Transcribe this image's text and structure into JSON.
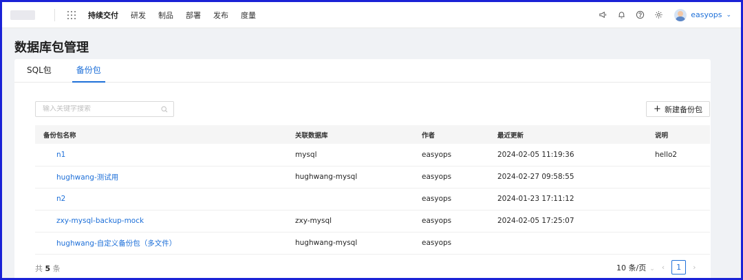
{
  "nav": {
    "items": [
      "持续交付",
      "研发",
      "制品",
      "部署",
      "发布",
      "度量"
    ],
    "username": "easyops"
  },
  "page": {
    "title": "数据库包管理"
  },
  "tabs": [
    {
      "label": "SQL包",
      "active": false
    },
    {
      "label": "备份包",
      "active": true
    }
  ],
  "search": {
    "placeholder": "输入关键字搜索",
    "value": ""
  },
  "new_button": {
    "label": "新建备份包"
  },
  "table": {
    "columns": [
      "备份包名称",
      "关联数据库",
      "作者",
      "最近更新",
      "说明"
    ],
    "rows": [
      [
        "n1",
        "mysql",
        "easyops",
        "2024-02-05 11:19:36",
        "hello2"
      ],
      [
        "hughwang-测试用",
        "hughwang-mysql",
        "easyops",
        "2024-02-27 09:58:55",
        ""
      ],
      [
        "n2",
        "",
        "easyops",
        "2024-01-23 17:11:12",
        ""
      ],
      [
        "zxy-mysql-backup-mock",
        "zxy-mysql",
        "easyops",
        "2024-02-05 17:25:07",
        ""
      ],
      [
        "hughwang-自定义备份包（多文件）",
        "hughwang-mysql",
        "easyops",
        "",
        ""
      ]
    ]
  },
  "footer": {
    "total_prefix": "共",
    "total_count": "5",
    "total_suffix": "条",
    "page_size": "10 条/页",
    "current_page": "1"
  },
  "colors": {
    "accent": "#1d6fd8",
    "frame": "#1a22d6"
  },
  "icons": [
    "apps-grid-icon",
    "megaphone-icon",
    "bell-icon",
    "help-icon",
    "gear-icon",
    "search-icon",
    "plus-icon"
  ]
}
